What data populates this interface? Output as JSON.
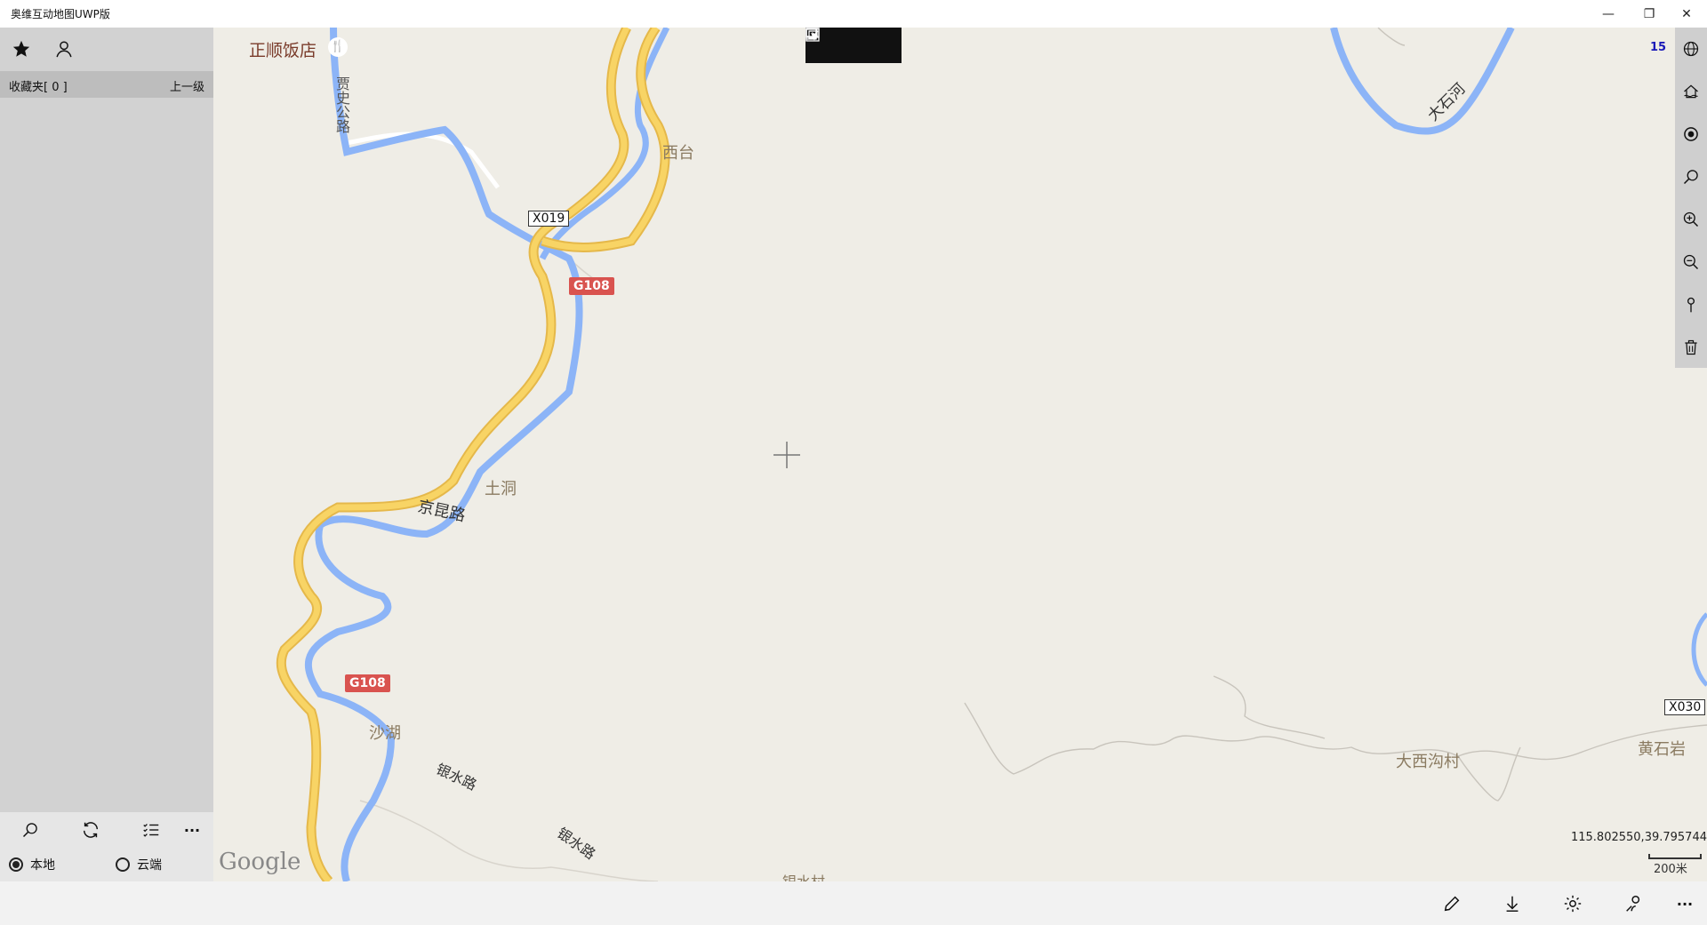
{
  "window": {
    "title": "奥维互动地图UWP版",
    "minimize_glyph": "—",
    "restore_glyph": "❐",
    "close_glyph": "✕"
  },
  "sidebar": {
    "top_icons": [
      "star-icon",
      "user-icon"
    ],
    "favorites_label": "收藏夹[ 0 ]",
    "up_label": "上一级",
    "tools": [
      "search-icon",
      "refresh-icon",
      "list-icon",
      "more-icon"
    ],
    "more_glyph": "···",
    "radio_local": "本地",
    "radio_cloud": "云端",
    "selected": "本地"
  },
  "map": {
    "zoom_level": "15",
    "coordinates": "115.802550,39.795744",
    "scale_label": "200米",
    "attribution": "Google",
    "labels": {
      "restaurant": "正顺饭店",
      "road_jiashi": "贾史公路",
      "xitai": "西台",
      "x019": "X019",
      "g108_a": "G108",
      "g108_b": "G108",
      "tudong": "土洞",
      "jingkun": "京昆路",
      "shahu": "沙湖",
      "yinshui_a": "银水路",
      "yinshui_b": "银水路",
      "yinshuicun": "银水村",
      "dashihe": "大石河",
      "daxigoucun": "大西沟村",
      "huangshiyan": "黄石岩",
      "x030": "X030"
    },
    "colors": {
      "background": "#efede6",
      "road": "#f8d465",
      "river": "#8cb4f7",
      "shield": "#d9534f"
    }
  },
  "right_toolbar": [
    "globe-icon",
    "layers-icon",
    "locate-icon",
    "search-icon",
    "zoom-in-icon",
    "zoom-out-icon",
    "pin-icon",
    "trash-icon"
  ],
  "bottom_toolbar": [
    "pencil-icon",
    "download-icon",
    "settings-icon",
    "route-icon",
    "more-icon"
  ],
  "bottom_more_glyph": "···"
}
